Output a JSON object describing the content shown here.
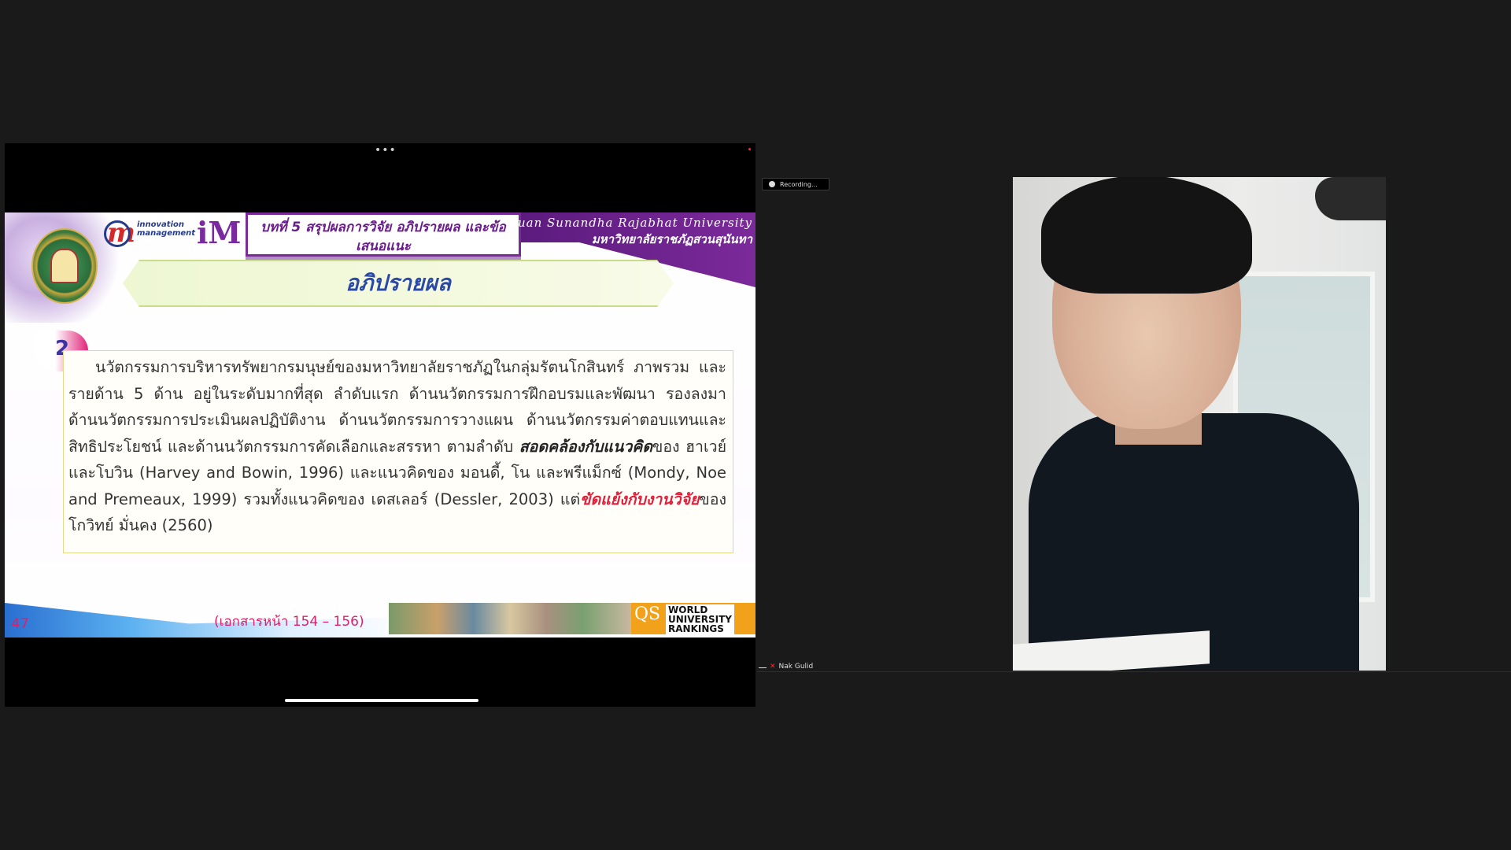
{
  "screen_share": {
    "menu_dots": "•••",
    "slide": {
      "chapter_title": "บทที่ 5 สรุปผลการวิจัย อภิปรายผล และข้อเสนอแนะ",
      "logo_m_letter": "m",
      "logo_text": "innovation\nmanagement",
      "logo_im": "iM",
      "university_en": "Suan Sunandha Rajabhat University",
      "university_th": "มหาวิทยาลัยราชภัฏสวนสุนันทา",
      "title": "อภิปรายผล",
      "item_number": "2",
      "paragraph": {
        "part1": "นวัตกรรมการบริหารทรัพยากรมนุษย์ของมหาวิทยาลัยราชภัฏในกลุ่มรัตนโกสินทร์ ภาพรวม และรายด้าน 5 ด้าน อยู่ในระดับมากที่สุด ลำดับแรก ด้านนวัตกรรมการฝึกอบรมและพัฒนา รองลงมา ด้านนวัตกรรมการประเมินผลปฏิบัติงาน ด้านนวัตกรรมการวางแผน ด้านนวัตกรรมค่าตอบแทนและสิทธิประโยชน์ และด้านนวัตกรรมการคัดเลือกและสรรหา ตามลำดับ ",
        "emphasis": "สอดคล้องกับแนวคิด",
        "part2": "ของ ฮาเวย์ และโบวิน (Harvey and Bowin, 1996) และแนวคิดของ มอนดี้, โน และพรีแม็กซ์ (Mondy, Noe and Premeaux, 1999) รวมทั้งแนวคิดของ เดสเลอร์ (Dessler, 2003) แต่",
        "contrast": "ขัดแย้งกับงานวิจัย",
        "part3": "ของ โกวิทย์ มั่นคง (2560)"
      },
      "page_number": "47",
      "pages_ref": "(เอกสารหน้า 154 – 156)",
      "qs_letters": "QS",
      "qs_text": "WORLD\nUNIVERSITY\nRANKINGS"
    }
  },
  "recording": {
    "label": "Recording..."
  },
  "participant": {
    "name": "Nak Gulid"
  }
}
